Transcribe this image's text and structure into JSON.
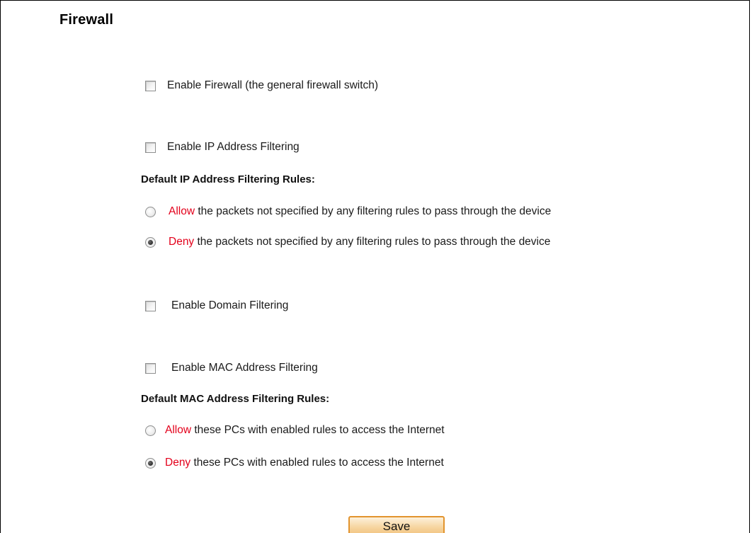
{
  "page": {
    "title": "Firewall"
  },
  "firewall": {
    "enable_label": "Enable Firewall (the general firewall switch)",
    "enabled": false
  },
  "ip_filtering": {
    "enable_label": "Enable IP Address Filtering",
    "enabled": false,
    "rules_heading": "Default IP Address Filtering Rules:",
    "options": [
      {
        "keyword": "Allow",
        "text": " the packets not specified by any filtering rules to pass through the device",
        "selected": false
      },
      {
        "keyword": "Deny",
        "text": " the packets not specified by any filtering rules to pass through the device",
        "selected": true
      }
    ]
  },
  "domain_filtering": {
    "enable_label": "Enable Domain Filtering",
    "enabled": false
  },
  "mac_filtering": {
    "enable_label": "Enable MAC Address Filtering",
    "enabled": false,
    "rules_heading": "Default MAC Address Filtering Rules:",
    "options": [
      {
        "keyword": "Allow",
        "text": " these PCs with enabled rules to access the Internet",
        "selected": false
      },
      {
        "keyword": "Deny",
        "text": " these PCs with enabled rules to access the Internet",
        "selected": true
      }
    ]
  },
  "actions": {
    "save_label": "Save"
  },
  "colors": {
    "keyword_red": "#e3001b",
    "button_border": "#e2942e",
    "button_fill": "#f6d49e"
  }
}
